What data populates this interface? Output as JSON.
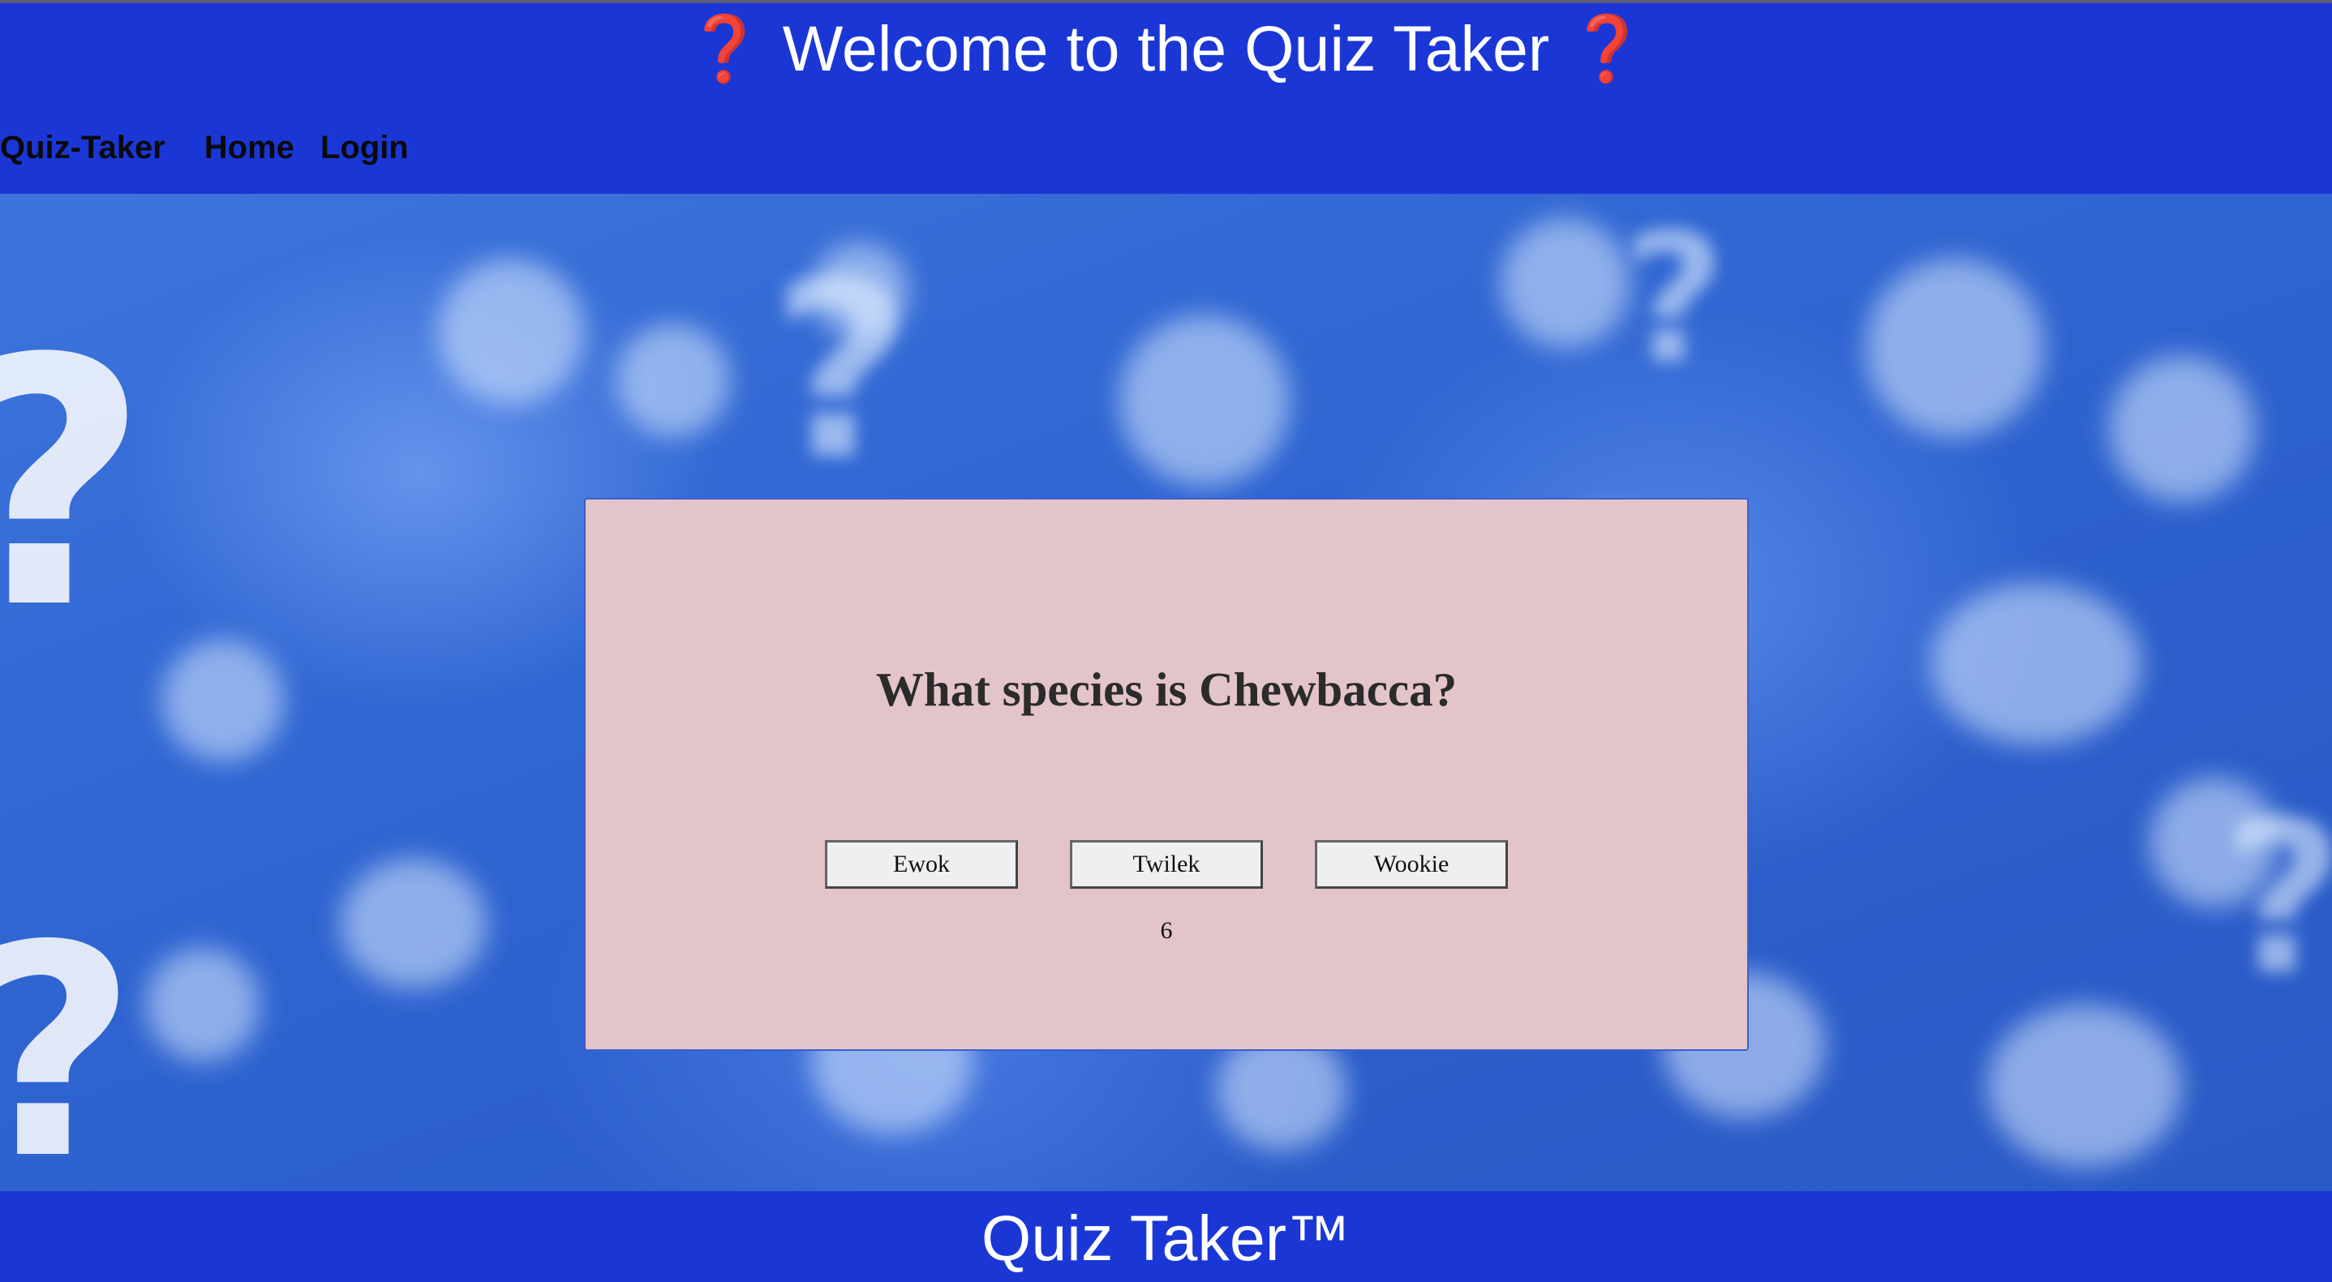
{
  "header": {
    "title_prefix_icon": "❓",
    "title_text": "Welcome to the Quiz Taker",
    "title_suffix_icon": "❓",
    "icon_color": "#d61620",
    "background": "#1a37d6"
  },
  "nav": {
    "brand": "Quiz-Taker",
    "items": [
      {
        "label": "Home"
      },
      {
        "label": "Login"
      }
    ]
  },
  "quiz": {
    "question": "What species is Chewbacca?",
    "answers": [
      {
        "label": "Ewok"
      },
      {
        "label": "Twilek"
      },
      {
        "label": "Wookie"
      }
    ],
    "timer": "6",
    "card_background": "#e3c5c9"
  },
  "footer": {
    "text": "Quiz Taker™"
  }
}
